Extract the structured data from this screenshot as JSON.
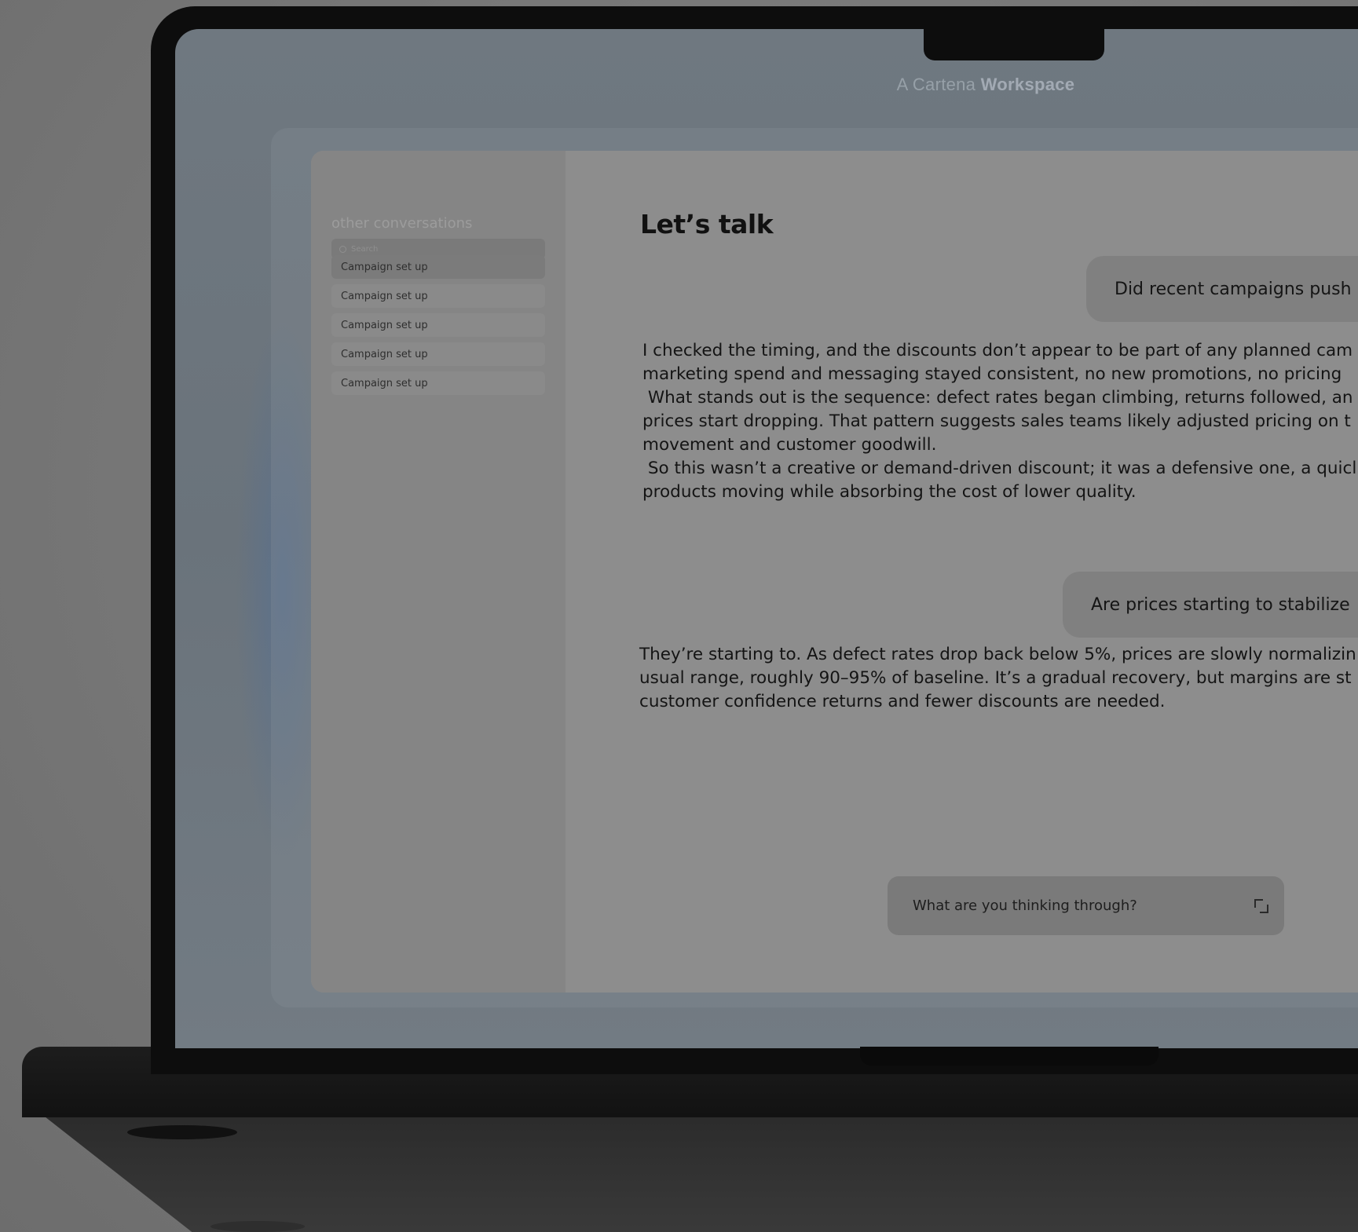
{
  "window": {
    "workspace_title_light": "A Cartena",
    "workspace_title_bold": "Workspace"
  },
  "sidebar": {
    "title": "other conversations",
    "search_placeholder": "Search",
    "items": [
      {
        "label": "Campaign set up",
        "active": true
      },
      {
        "label": "Campaign set up",
        "active": false
      },
      {
        "label": "Campaign set up",
        "active": false
      },
      {
        "label": "Campaign set up",
        "active": false
      },
      {
        "label": "Campaign set up",
        "active": false
      }
    ]
  },
  "main": {
    "title": "Let’s talk",
    "messages": [
      {
        "role": "user",
        "text": "Did recent campaigns push"
      },
      {
        "role": "assistant",
        "text": "I checked the timing, and the discounts don’t appear to be part of any planned cam\nmarketing spend and messaging stayed consistent, no new promotions, no pricing\n What stands out is the sequence: defect rates began climbing, returns followed, an\nprices start dropping. That pattern suggests sales teams likely adjusted pricing on t\nmovement and customer goodwill.\n So this wasn’t a creative or demand-driven discount; it was a defensive one, a quicl\nproducts moving while absorbing the cost of lower quality."
      },
      {
        "role": "user",
        "text": "Are prices starting to stabilize"
      },
      {
        "role": "assistant",
        "text": "They’re starting to. As defect rates drop back below 5%, prices are slowly normalizin\nusual range, roughly 90–95% of baseline. It’s a gradual recovery, but margins are st\ncustomer confidence returns and fewer discounts are needed."
      }
    ]
  },
  "composer": {
    "placeholder": "What are you thinking through?",
    "icon": "expand-icon"
  },
  "colors": {
    "background": "#7a7a7a",
    "laptop_body": "#0d0d0d",
    "app_surface": "#8d8d8d",
    "sidebar": "#858585",
    "bubble": "#808080"
  }
}
